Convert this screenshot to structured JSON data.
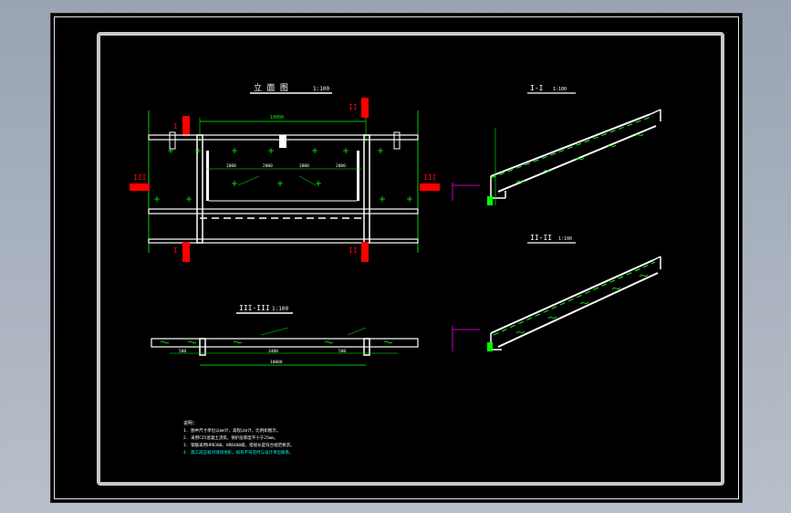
{
  "drawing": {
    "title_plan": "立 面 图",
    "scale_plan": "1:100",
    "title_s1": "I-I",
    "scale_s1": "1:100",
    "title_s2": "II-II",
    "scale_s2": "1:100",
    "title_s3": "III-III",
    "scale_s3": "1:100",
    "marker_I": "I",
    "marker_II": "II",
    "marker_III": "III",
    "dim_total": "10000",
    "dim_span_a": "2000",
    "dim_span_b": "2000",
    "dim_span_c": "2000",
    "dim_span_d": "2000",
    "dim_end_a": "500",
    "dim_end_b": "500",
    "dim_mid": "3400",
    "notes_heading": "说明:",
    "notes": [
      "1. 图中尺寸单位以mm计，高程以m计，比例如图示。",
      "2. 采用C25混凝土浇筑，保护层厚度不小于25mm。",
      "3. 钢筋采用HPB300、HRB400级，搭接长度符合规范要求。",
      "4. 施工前应核对现场地形，如有不符及时与设计单位联系。"
    ]
  }
}
